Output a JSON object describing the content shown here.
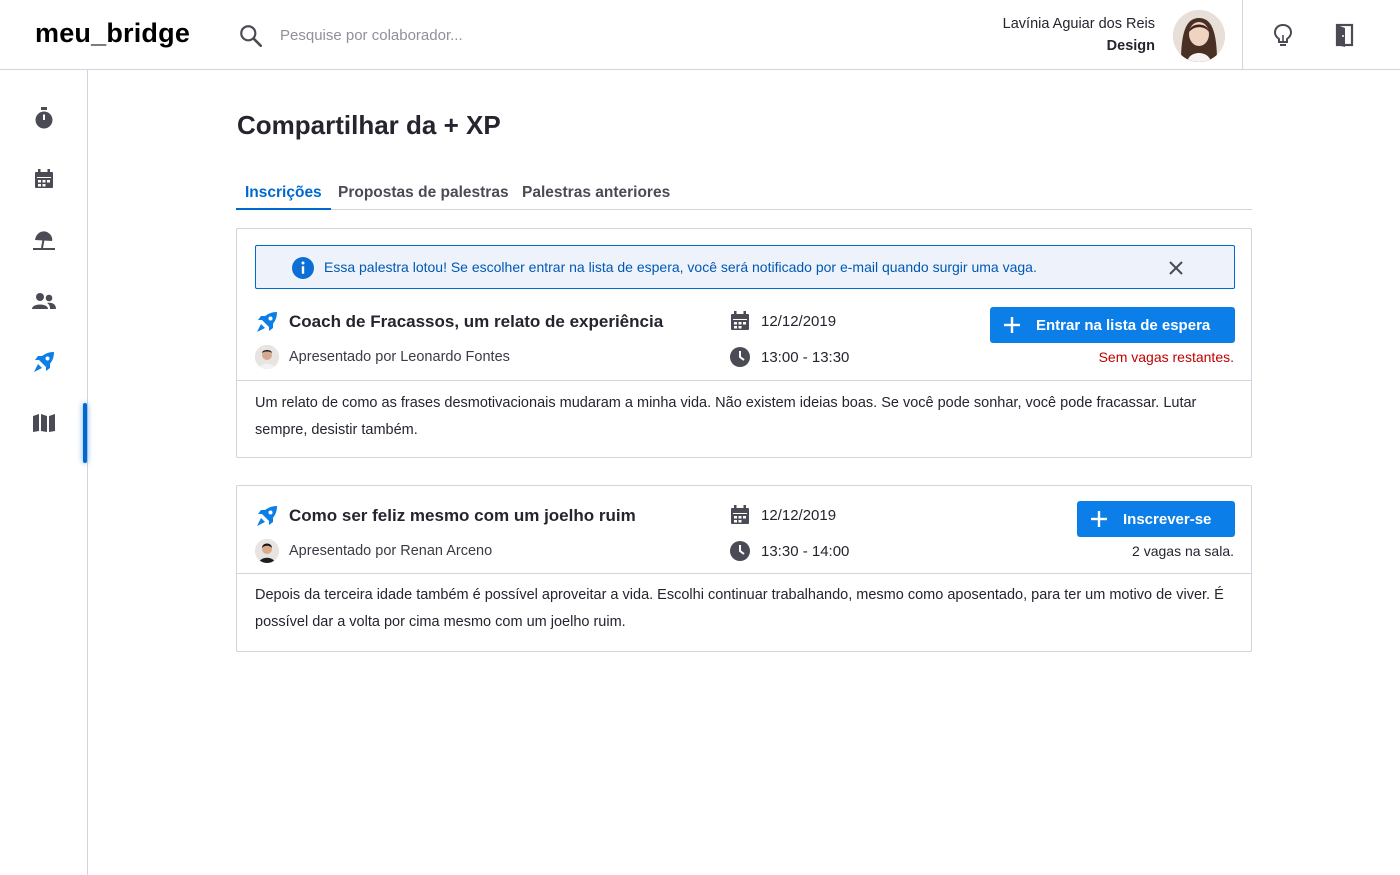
{
  "app": {
    "logo": "meu_bridge"
  },
  "search": {
    "placeholder": "Pesquise por colaborador..."
  },
  "user": {
    "name": "Lavínia Aguiar dos Reis",
    "department": "Design"
  },
  "page": {
    "title": "Compartilhar da + XP"
  },
  "tabs": [
    {
      "label": "Inscrições",
      "active": true
    },
    {
      "label": "Propostas de palestras",
      "active": false
    },
    {
      "label": "Palestras anteriores",
      "active": false
    }
  ],
  "sidebar": {
    "items": [
      {
        "icon": "stopwatch-icon"
      },
      {
        "icon": "calendar-icon"
      },
      {
        "icon": "beach-umbrella-icon"
      },
      {
        "icon": "people-icon"
      },
      {
        "icon": "rocket-icon",
        "active": true
      },
      {
        "icon": "map-icon"
      }
    ]
  },
  "header_actions": [
    {
      "icon": "lightbulb-icon"
    },
    {
      "icon": "logout-door-icon"
    }
  ],
  "talks": [
    {
      "alert": "Essa palestra lotou! Se escolher entrar na lista de espera, você será notificado por e-mail quando surgir uma vaga.",
      "title": "Coach de Fracassos, um relato de experiência",
      "presenter": "Apresentado por Leonardo Fontes",
      "date": "12/12/2019",
      "time": "13:00 - 13:30",
      "button_label": "Entrar na lista de espera",
      "status": "Sem vagas restantes.",
      "description": "Um relato de como as frases desmotivacionais mudaram a minha vida. Não existem ideias boas. Se você pode sonhar, você pode fracassar. Lutar sempre, desistir também."
    },
    {
      "title": "Como ser feliz mesmo com um joelho ruim",
      "presenter": "Apresentado por Renan Arceno",
      "date": "12/12/2019",
      "time": "13:30 - 14:00",
      "button_label": "Inscrever-se",
      "status": "2 vagas na sala.",
      "description": "Depois da terceira idade também é possível aproveitar a vida. Escolhi continuar trabalhando, mesmo como aposentado, para ter um motivo de viver. É possível dar a volta por cima mesmo com um joelho ruim."
    }
  ],
  "colors": {
    "primary": "#0B7FE7",
    "link": "#0069D0",
    "error": "#C00000",
    "alert_bg": "#EEF3FB",
    "icon_gray": "#4A4B55"
  }
}
